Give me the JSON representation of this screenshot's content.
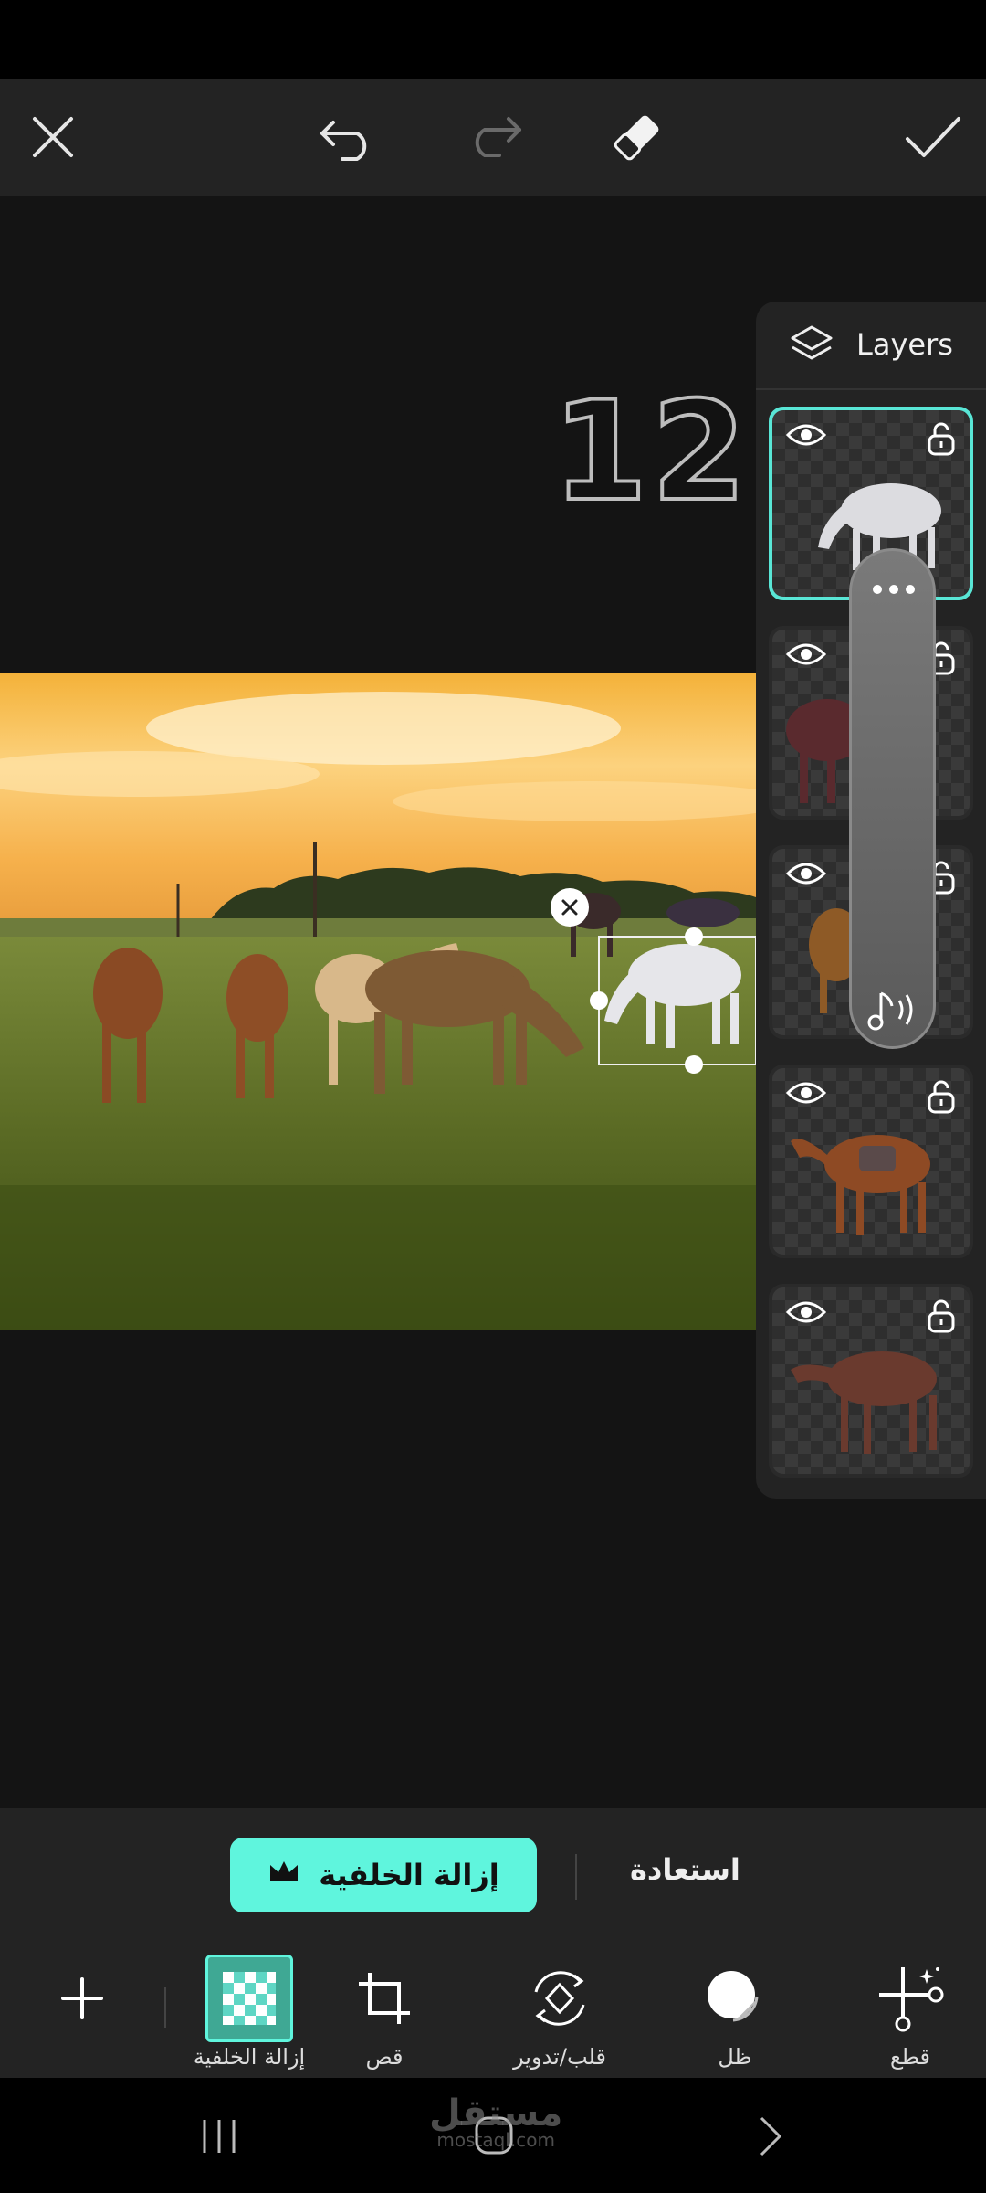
{
  "topbar": {
    "close": "close-icon",
    "undo": "undo-icon",
    "redo": "redo-icon",
    "eraser": "eraser-icon",
    "apply": "check-icon"
  },
  "canvas": {
    "sticker_text": "12"
  },
  "layers": {
    "title": "Layers",
    "items": [
      {
        "subject": "white horse",
        "selected": true
      },
      {
        "subject": "dark brown horse",
        "selected": false
      },
      {
        "subject": "chestnut horse",
        "selected": false
      },
      {
        "subject": "saddled bay horse",
        "selected": false
      },
      {
        "subject": "dark bay horse",
        "selected": false
      }
    ]
  },
  "bottom": {
    "remove_bg_button": "إزالة الخلفية",
    "restore_button": "استعادة",
    "tools": [
      {
        "label": "قطع",
        "icon": "cutout-icon"
      },
      {
        "label": "ظل",
        "icon": "shadow-icon"
      },
      {
        "label": "قلب/تدوير",
        "icon": "flip-rotate-icon"
      },
      {
        "label": "قص",
        "icon": "crop-icon"
      },
      {
        "label": "إزالة الخلفية",
        "icon": "remove-background-icon",
        "active": true
      }
    ],
    "add": "plus-icon"
  },
  "watermark": {
    "line1": "مستقل",
    "line2": "mostaql.com"
  },
  "colors": {
    "accent": "#5ff5dd",
    "selected_border": "#59e6d6",
    "panel": "#232323",
    "background": "#141414"
  }
}
